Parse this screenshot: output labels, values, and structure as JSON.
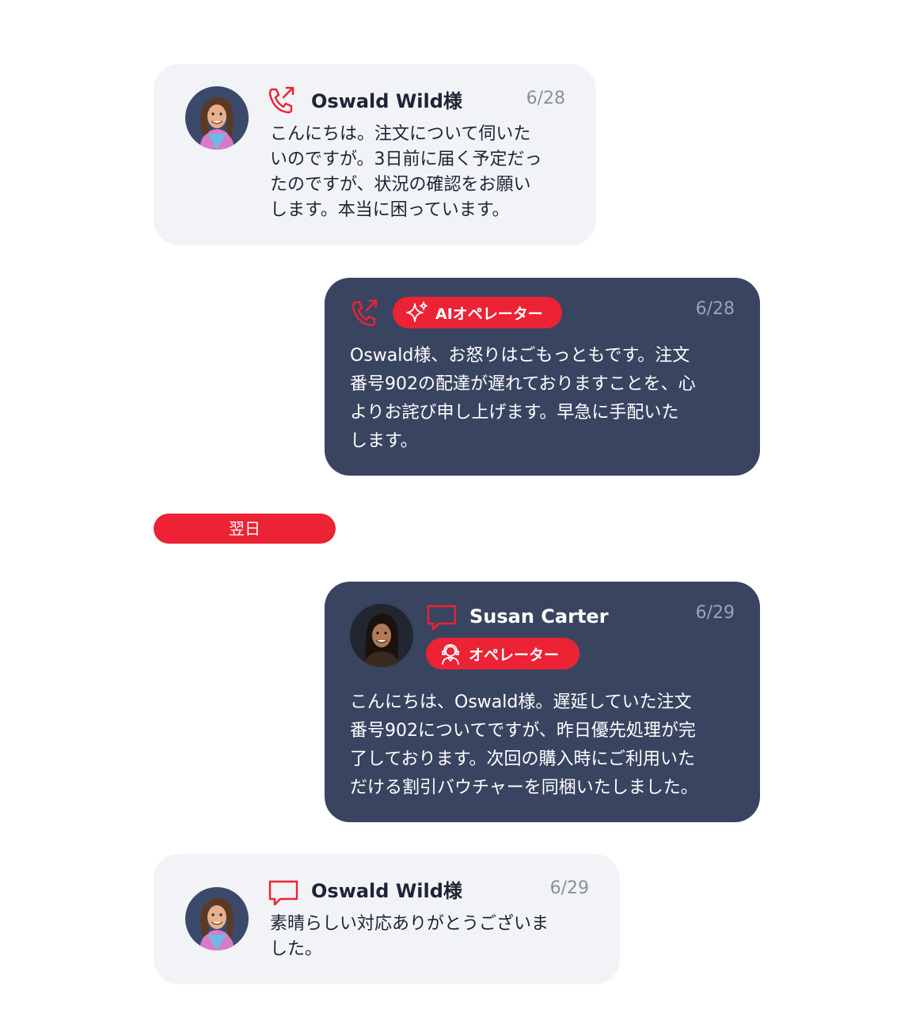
{
  "colors": {
    "accent": "#ec2235",
    "customer_bubble": "#f1f3f6",
    "agent_bubble": "#394460"
  },
  "divider": {
    "label": "翌日"
  },
  "messages": [
    {
      "sender": "Oswald Wild様",
      "date": "6/28",
      "channel_icon": "phone-outgoing-icon",
      "lines": [
        "こんにちは。注文について伺いた",
        "いのですが。3日前に届く予定だっ",
        "たのですが、状況の確認をお願い",
        "します。本当に困っています。"
      ]
    },
    {
      "badge": "AIオペレーター",
      "badge_icon": "sparkle-icon",
      "date": "6/28",
      "channel_icon": "phone-outgoing-icon",
      "lines": [
        "Oswald様、お怒りはごもっともです。注文",
        "番号902の配達が遅れておりますことを、心",
        "よりお詫び申し上げます。早急に手配いた",
        "します。"
      ]
    },
    {
      "sender": "Susan Carter",
      "badge": "オペレーター",
      "badge_icon": "operator-headset-icon",
      "date": "6/29",
      "channel_icon": "chat-bubble-icon",
      "lines": [
        "こんにちは、Oswald様。遅延していた注文",
        "番号902についてですが、昨日優先処理が完",
        "了しております。次回の購入時にご利用いた",
        "だける割引バウチャーを同梱いたしました。"
      ]
    },
    {
      "sender": "Oswald Wild様",
      "date": "6/29",
      "channel_icon": "chat-bubble-icon",
      "lines": [
        "素晴らしい対応ありがとうございま",
        "した。"
      ]
    }
  ]
}
